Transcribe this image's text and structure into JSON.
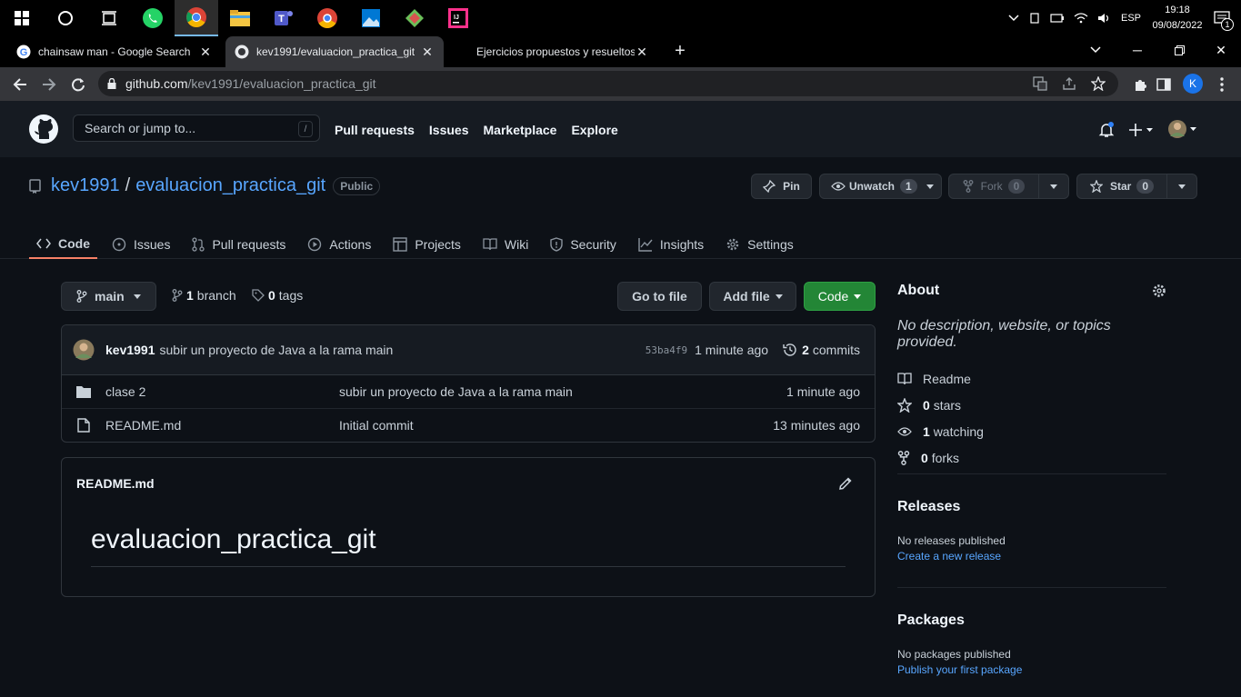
{
  "taskbar": {
    "lang": "ESP",
    "time": "19:18",
    "date": "09/08/2022",
    "notif_count": "1"
  },
  "browser": {
    "tabs": [
      {
        "title": "chainsaw man - Google Search"
      },
      {
        "title": "kev1991/evaluacion_practica_git"
      },
      {
        "title": "Ejercicios propuestos y resueltos"
      }
    ],
    "url_host": "github.com",
    "url_path": "/kev1991/evaluacion_practica_git",
    "profile_initial": "K"
  },
  "gh_header": {
    "search_placeholder": "Search or jump to...",
    "slash": "/",
    "nav": [
      "Pull requests",
      "Issues",
      "Marketplace",
      "Explore"
    ]
  },
  "repo": {
    "owner": "kev1991",
    "sep": "/",
    "name": "evaluacion_practica_git",
    "visibility": "Public",
    "pin_label": "Pin",
    "unwatch_label": "Unwatch",
    "watch_count": "1",
    "fork_label": "Fork",
    "fork_count": "0",
    "star_label": "Star",
    "star_count": "0",
    "tabs": [
      "Code",
      "Issues",
      "Pull requests",
      "Actions",
      "Projects",
      "Wiki",
      "Security",
      "Insights",
      "Settings"
    ]
  },
  "branchbar": {
    "branch": "main",
    "branch_count": "1",
    "branch_word": "branch",
    "tag_count": "0",
    "tag_word": "tags",
    "goto_file": "Go to file",
    "add_file": "Add file",
    "code": "Code"
  },
  "commit": {
    "author": "kev1991",
    "message": "subir un proyecto de Java a la rama main",
    "sha": "53ba4f9",
    "time": "1 minute ago",
    "commit_count": "2",
    "commit_word": "commits"
  },
  "files": [
    {
      "name": "clase 2",
      "message": "subir un proyecto de Java a la rama main",
      "time": "1 minute ago",
      "type": "folder"
    },
    {
      "name": "README.md",
      "message": "Initial commit",
      "time": "13 minutes ago",
      "type": "file"
    }
  ],
  "readme": {
    "filename": "README.md",
    "heading": "evaluacion_practica_git"
  },
  "about": {
    "title": "About",
    "description": "No description, website, or topics provided.",
    "readme": "Readme",
    "stars_count": "0",
    "stars_word": "stars",
    "watching_count": "1",
    "watching_word": "watching",
    "forks_count": "0",
    "forks_word": "forks"
  },
  "releases": {
    "title": "Releases",
    "none": "No releases published",
    "create": "Create a new release"
  },
  "packages": {
    "title": "Packages",
    "none": "No packages published",
    "publish": "Publish your first package"
  },
  "colors": {
    "accent_link": "#58a6ff",
    "code_button": "#238636",
    "tab_underline": "#f78166",
    "bg": "#0d1117"
  }
}
